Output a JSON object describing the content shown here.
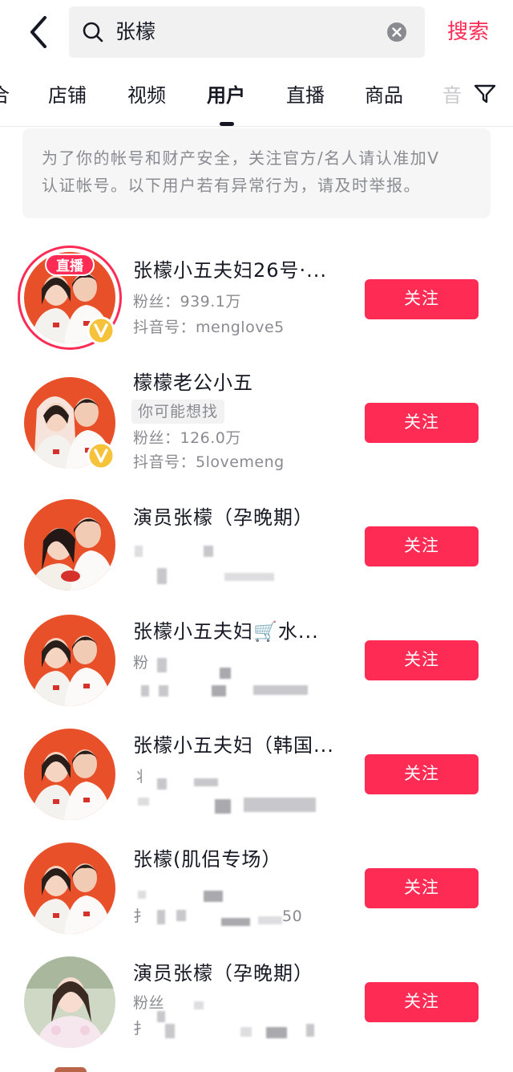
{
  "search": {
    "query": "张檬",
    "submit_label": "搜索"
  },
  "tabs": [
    {
      "label": "合"
    },
    {
      "label": "店铺"
    },
    {
      "label": "视频"
    },
    {
      "label": "用户"
    },
    {
      "label": "直播"
    },
    {
      "label": "商品"
    },
    {
      "label": "音"
    }
  ],
  "notice": {
    "line1": "为了你的帐号和财产安全，关注官方/名人请认准加V",
    "line2": "认证帐号。以下用户若有异常行为，请及时举报。"
  },
  "colors": {
    "accent": "#fe2c55",
    "avatar_bg": "#e8502a",
    "verified_gold": "#f5c23a"
  },
  "users": [
    {
      "name": "张檬小五夫妇26号·...",
      "live_badge": "直播",
      "fans": "粉丝：939.1万",
      "douyin_id": "抖音号：menglove5",
      "follow_label": "关注"
    },
    {
      "name": "檬檬老公小五",
      "tag": "你可能想找",
      "fans": "粉丝：126.0万",
      "douyin_id": "抖音号：5lovemeng",
      "follow_label": "关注"
    },
    {
      "name": "演员张檬（孕晚期）",
      "follow_label": "关注"
    },
    {
      "name": "张檬小五夫妇🛒水...",
      "meta1": "粉",
      "follow_label": "关注"
    },
    {
      "name": "张檬小五夫妇（韩国...",
      "meta1": "丬",
      "follow_label": "关注"
    },
    {
      "name": "张檬(肌侣专场）",
      "meta2": "扌",
      "meta2_end": "50",
      "follow_label": "关注"
    },
    {
      "name": "演员张檬（孕晚期）",
      "meta1": "粉丝",
      "meta2": "扌",
      "follow_label": "关注"
    }
  ]
}
